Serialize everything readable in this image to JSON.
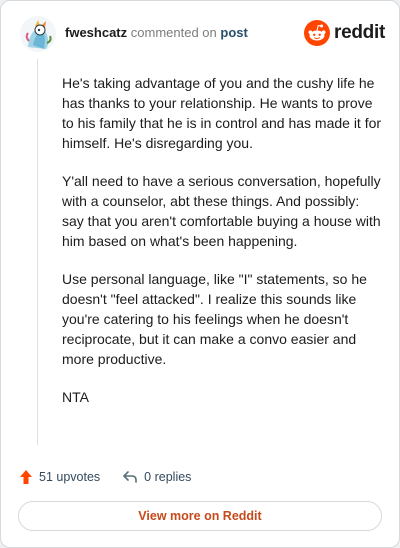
{
  "comment": {
    "username": "fweshcatz",
    "action_text": "commented on",
    "post_link": "post",
    "paragraphs": [
      "He's taking advantage of you and the cushy life he has thanks to your relationship. He wants to prove to his family that he is in control and has made it for himself. He's disregarding you.",
      "Y'all need to have a serious conversation, hopefully with a counselor, abt these things. And possibly: say that you aren't comfortable buying a house with him based on what's been happening.",
      "Use personal language, like \"I\" statements, so he doesn't \"feel attacked\". I realize this sounds like you're catering to his feelings when he doesn't reciprocate, but it can make a convo easier and more productive.",
      "NTA"
    ]
  },
  "brand": {
    "name": "reddit",
    "icon": "reddit-logo-icon",
    "color": "#ff4500"
  },
  "actions": {
    "upvotes_label": "51 upvotes",
    "replies_label": "0 replies",
    "upvote_icon": "upvote-arrow-icon",
    "reply_icon": "reply-arrow-icon",
    "upvote_color": "#ff4500"
  },
  "footer": {
    "view_more_label": "View more on Reddit",
    "accent_color": "#c64a1b"
  }
}
